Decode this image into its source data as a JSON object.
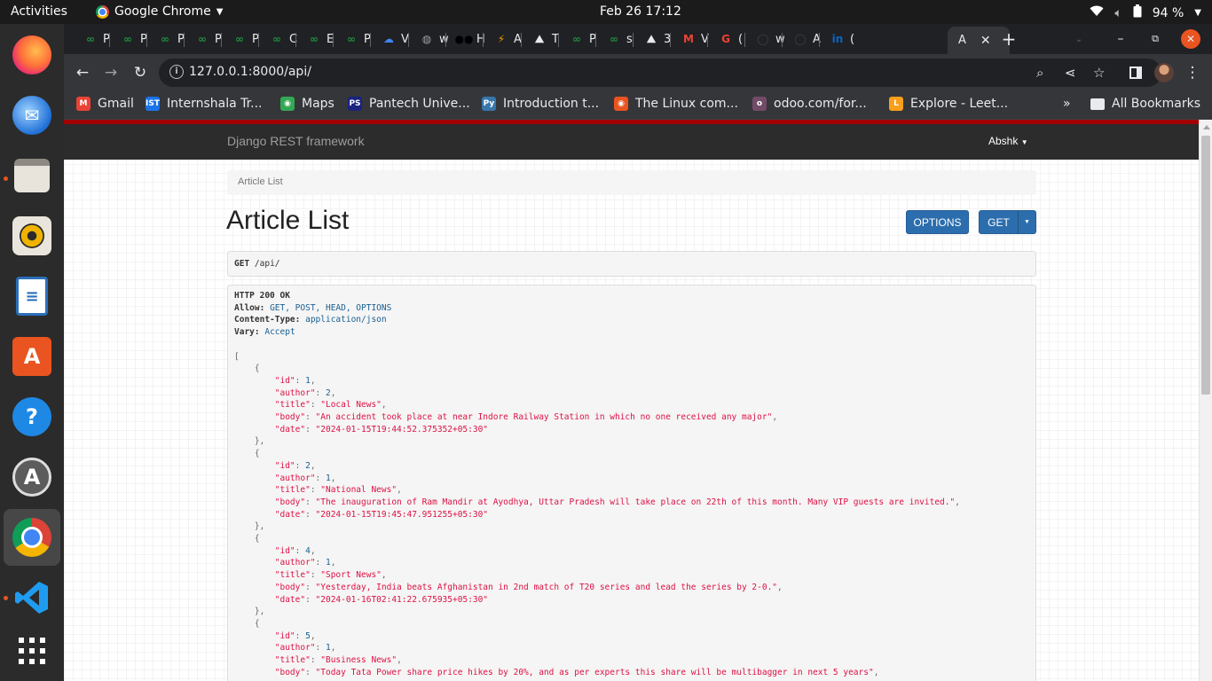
{
  "system": {
    "activities": "Activities",
    "app_name": "Google Chrome",
    "clock": "Feb 26  17:12",
    "battery": "94 %"
  },
  "tabs": [
    {
      "letter": "P",
      "color": "#1e8e3e",
      "glyph": "∞"
    },
    {
      "letter": "P",
      "color": "#1e8e3e",
      "glyph": "∞"
    },
    {
      "letter": "P",
      "color": "#1e8e3e",
      "glyph": "∞"
    },
    {
      "letter": "P",
      "color": "#1e8e3e",
      "glyph": "∞"
    },
    {
      "letter": "P",
      "color": "#1e8e3e",
      "glyph": "∞"
    },
    {
      "letter": "C",
      "color": "#1e8e3e",
      "glyph": "∞"
    },
    {
      "letter": "E",
      "color": "#1e8e3e",
      "glyph": "∞"
    },
    {
      "letter": "P",
      "color": "#1e8e3e",
      "glyph": "∞"
    },
    {
      "letter": "V",
      "color": "#4285f4",
      "glyph": "☁"
    },
    {
      "letter": "w",
      "color": "#9aa0a6",
      "glyph": "◍"
    },
    {
      "letter": "H",
      "color": "#000000",
      "glyph": "●●"
    },
    {
      "letter": "A",
      "color": "#f29900",
      "glyph": "⚡"
    },
    {
      "letter": "T",
      "color": "#e8eaed",
      "glyph": "⛰"
    },
    {
      "letter": "P",
      "color": "#1e8e3e",
      "glyph": "∞"
    },
    {
      "letter": "s",
      "color": "#1e8e3e",
      "glyph": "∞"
    },
    {
      "letter": "3",
      "color": "#e8eaed",
      "glyph": "⛰"
    },
    {
      "letter": "V",
      "color": "#ea4335",
      "glyph": "M"
    },
    {
      "letter": "(",
      "color": "#ea4335",
      "glyph": "G"
    },
    {
      "letter": "w",
      "color": "#3c4043",
      "glyph": "◯"
    },
    {
      "letter": "A",
      "color": "#3c4043",
      "glyph": "◯"
    },
    {
      "letter": "(",
      "color": "#0a66c2",
      "glyph": "in"
    }
  ],
  "active_tab": {
    "letter": "A"
  },
  "toolbar": {
    "url": "127.0.0.1:8000/api/"
  },
  "bookmarks": [
    {
      "label": "Gmail",
      "color": "#ea4335",
      "glyph": "M"
    },
    {
      "label": "Internshala Tr...",
      "color": "#1a73e8",
      "glyph": "IST"
    },
    {
      "label": "Maps",
      "color": "#34a853",
      "glyph": "◉"
    },
    {
      "label": "Pantech Unive...",
      "color": "#1a237e",
      "glyph": "PS"
    },
    {
      "label": "Introduction t...",
      "color": "#3776ab",
      "glyph": "Py"
    },
    {
      "label": "The Linux com...",
      "color": "#e95420",
      "glyph": "◉"
    },
    {
      "label": "odoo.com/for...",
      "color": "#714b67",
      "glyph": "o"
    },
    {
      "label": "Explore - Leet...",
      "color": "#f89f1b",
      "glyph": "L"
    }
  ],
  "all_bookmarks": "All Bookmarks",
  "drf": {
    "brand": "Django REST framework",
    "user": "Abshk",
    "breadcrumb": "Article List",
    "title": "Article List",
    "options_button": "OPTIONS",
    "get_button": "GET",
    "request_method": "GET",
    "request_path": "/api/",
    "status_line": "HTTP 200 OK",
    "headers": [
      {
        "name": "Allow:",
        "value": "GET, POST, HEAD, OPTIONS"
      },
      {
        "name": "Content-Type:",
        "value": "application/json"
      },
      {
        "name": "Vary:",
        "value": "Accept"
      }
    ],
    "articles": [
      {
        "id": "1",
        "author": "2",
        "title": "\"Local News\"",
        "body": "\"An accident took place at near Indore Railway Station in which no one received any major\"",
        "date": "\"2024-01-15T19:44:52.375352+05:30\""
      },
      {
        "id": "2",
        "author": "1",
        "title": "\"National News\"",
        "body": "\"The inauguration of Ram Mandir at Ayodhya, Uttar Pradesh will take place on 22th of this month. Many VIP guests are invited.\"",
        "date": "\"2024-01-15T19:45:47.951255+05:30\""
      },
      {
        "id": "4",
        "author": "1",
        "title": "\"Sport News\"",
        "body": "\"Yesterday, India beats Afghanistan in 2nd match of T20 series and lead the series by 2-0.\"",
        "date": "\"2024-01-16T02:41:22.675935+05:30\""
      },
      {
        "id": "5",
        "author": "1",
        "title": "\"Business News\"",
        "body": "\"Today Tata Power share price hikes by 20%, and as per experts this share will be multibagger in next 5 years\"",
        "date": ""
      }
    ]
  }
}
